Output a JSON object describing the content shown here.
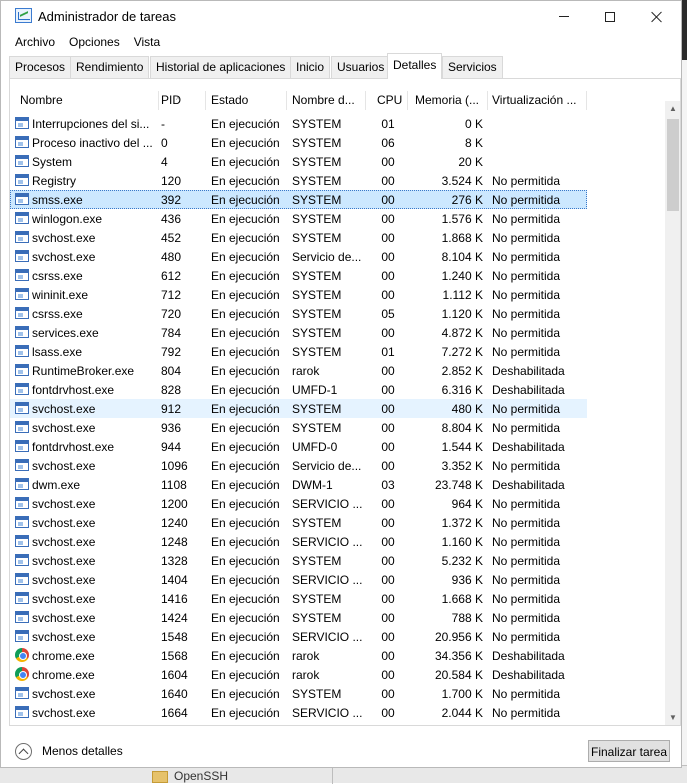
{
  "window": {
    "title": "Administrador de tareas"
  },
  "menu": [
    "Archivo",
    "Opciones",
    "Vista"
  ],
  "tabs": [
    {
      "label": "Procesos",
      "active": false
    },
    {
      "label": "Rendimiento",
      "active": false
    },
    {
      "label": "Historial de aplicaciones",
      "active": false
    },
    {
      "label": "Inicio",
      "active": false
    },
    {
      "label": "Usuarios",
      "active": false
    },
    {
      "label": "Detalles",
      "active": true
    },
    {
      "label": "Servicios",
      "active": false
    }
  ],
  "columns": [
    "Nombre",
    "PID",
    "Estado",
    "Nombre d...",
    "CPU",
    "Memoria (...",
    "Virtualización ..."
  ],
  "rows": [
    {
      "icon": "window-icon",
      "name": "Interrupciones del si...",
      "pid": "-",
      "estado": "En ejecución",
      "user": "SYSTEM",
      "cpu": "01",
      "mem": "0 K",
      "virt": ""
    },
    {
      "icon": "window-icon",
      "name": "Proceso inactivo del ...",
      "pid": "0",
      "estado": "En ejecución",
      "user": "SYSTEM",
      "cpu": "06",
      "mem": "8 K",
      "virt": ""
    },
    {
      "icon": "window-icon",
      "name": "System",
      "pid": "4",
      "estado": "En ejecución",
      "user": "SYSTEM",
      "cpu": "00",
      "mem": "20 K",
      "virt": ""
    },
    {
      "icon": "window-icon",
      "name": "Registry",
      "pid": "120",
      "estado": "En ejecución",
      "user": "SYSTEM",
      "cpu": "00",
      "mem": "3.524 K",
      "virt": "No permitida"
    },
    {
      "icon": "window-icon",
      "name": "smss.exe",
      "pid": "392",
      "estado": "En ejecución",
      "user": "SYSTEM",
      "cpu": "00",
      "mem": "276 K",
      "virt": "No permitida",
      "state": "selected"
    },
    {
      "icon": "window-icon",
      "name": "winlogon.exe",
      "pid": "436",
      "estado": "En ejecución",
      "user": "SYSTEM",
      "cpu": "00",
      "mem": "1.576 K",
      "virt": "No permitida"
    },
    {
      "icon": "window-icon",
      "name": "svchost.exe",
      "pid": "452",
      "estado": "En ejecución",
      "user": "SYSTEM",
      "cpu": "00",
      "mem": "1.868 K",
      "virt": "No permitida"
    },
    {
      "icon": "window-icon",
      "name": "svchost.exe",
      "pid": "480",
      "estado": "En ejecución",
      "user": "Servicio de...",
      "cpu": "00",
      "mem": "8.104 K",
      "virt": "No permitida"
    },
    {
      "icon": "window-icon",
      "name": "csrss.exe",
      "pid": "612",
      "estado": "En ejecución",
      "user": "SYSTEM",
      "cpu": "00",
      "mem": "1.240 K",
      "virt": "No permitida"
    },
    {
      "icon": "window-icon",
      "name": "wininit.exe",
      "pid": "712",
      "estado": "En ejecución",
      "user": "SYSTEM",
      "cpu": "00",
      "mem": "1.112 K",
      "virt": "No permitida"
    },
    {
      "icon": "window-icon",
      "name": "csrss.exe",
      "pid": "720",
      "estado": "En ejecución",
      "user": "SYSTEM",
      "cpu": "05",
      "mem": "1.120 K",
      "virt": "No permitida"
    },
    {
      "icon": "window-icon",
      "name": "services.exe",
      "pid": "784",
      "estado": "En ejecución",
      "user": "SYSTEM",
      "cpu": "00",
      "mem": "4.872 K",
      "virt": "No permitida"
    },
    {
      "icon": "window-icon",
      "name": "lsass.exe",
      "pid": "792",
      "estado": "En ejecución",
      "user": "SYSTEM",
      "cpu": "01",
      "mem": "7.272 K",
      "virt": "No permitida"
    },
    {
      "icon": "window-icon",
      "name": "RuntimeBroker.exe",
      "pid": "804",
      "estado": "En ejecución",
      "user": "rarok",
      "cpu": "00",
      "mem": "2.852 K",
      "virt": "Deshabilitada"
    },
    {
      "icon": "window-icon",
      "name": "fontdrvhost.exe",
      "pid": "828",
      "estado": "En ejecución",
      "user": "UMFD-1",
      "cpu": "00",
      "mem": "6.316 K",
      "virt": "Deshabilitada"
    },
    {
      "icon": "window-icon",
      "name": "svchost.exe",
      "pid": "912",
      "estado": "En ejecución",
      "user": "SYSTEM",
      "cpu": "00",
      "mem": "480 K",
      "virt": "No permitida",
      "state": "hover"
    },
    {
      "icon": "window-icon",
      "name": "svchost.exe",
      "pid": "936",
      "estado": "En ejecución",
      "user": "SYSTEM",
      "cpu": "00",
      "mem": "8.804 K",
      "virt": "No permitida"
    },
    {
      "icon": "window-icon",
      "name": "fontdrvhost.exe",
      "pid": "944",
      "estado": "En ejecución",
      "user": "UMFD-0",
      "cpu": "00",
      "mem": "1.544 K",
      "virt": "Deshabilitada"
    },
    {
      "icon": "window-icon",
      "name": "svchost.exe",
      "pid": "1096",
      "estado": "En ejecución",
      "user": "Servicio de...",
      "cpu": "00",
      "mem": "3.352 K",
      "virt": "No permitida"
    },
    {
      "icon": "window-icon",
      "name": "dwm.exe",
      "pid": "1108",
      "estado": "En ejecución",
      "user": "DWM-1",
      "cpu": "03",
      "mem": "23.748 K",
      "virt": "Deshabilitada"
    },
    {
      "icon": "window-icon",
      "name": "svchost.exe",
      "pid": "1200",
      "estado": "En ejecución",
      "user": "SERVICIO ...",
      "cpu": "00",
      "mem": "964 K",
      "virt": "No permitida"
    },
    {
      "icon": "window-icon",
      "name": "svchost.exe",
      "pid": "1240",
      "estado": "En ejecución",
      "user": "SYSTEM",
      "cpu": "00",
      "mem": "1.372 K",
      "virt": "No permitida"
    },
    {
      "icon": "window-icon",
      "name": "svchost.exe",
      "pid": "1248",
      "estado": "En ejecución",
      "user": "SERVICIO ...",
      "cpu": "00",
      "mem": "1.160 K",
      "virt": "No permitida"
    },
    {
      "icon": "window-icon",
      "name": "svchost.exe",
      "pid": "1328",
      "estado": "En ejecución",
      "user": "SYSTEM",
      "cpu": "00",
      "mem": "5.232 K",
      "virt": "No permitida"
    },
    {
      "icon": "window-icon",
      "name": "svchost.exe",
      "pid": "1404",
      "estado": "En ejecución",
      "user": "SERVICIO ...",
      "cpu": "00",
      "mem": "936 K",
      "virt": "No permitida"
    },
    {
      "icon": "window-icon",
      "name": "svchost.exe",
      "pid": "1416",
      "estado": "En ejecución",
      "user": "SYSTEM",
      "cpu": "00",
      "mem": "1.668 K",
      "virt": "No permitida"
    },
    {
      "icon": "window-icon",
      "name": "svchost.exe",
      "pid": "1424",
      "estado": "En ejecución",
      "user": "SYSTEM",
      "cpu": "00",
      "mem": "788 K",
      "virt": "No permitida"
    },
    {
      "icon": "window-icon",
      "name": "svchost.exe",
      "pid": "1548",
      "estado": "En ejecución",
      "user": "SERVICIO ...",
      "cpu": "00",
      "mem": "20.956 K",
      "virt": "No permitida"
    },
    {
      "icon": "chrome-icon",
      "name": "chrome.exe",
      "pid": "1568",
      "estado": "En ejecución",
      "user": "rarok",
      "cpu": "00",
      "mem": "34.356 K",
      "virt": "Deshabilitada"
    },
    {
      "icon": "chrome-icon",
      "name": "chrome.exe",
      "pid": "1604",
      "estado": "En ejecución",
      "user": "rarok",
      "cpu": "00",
      "mem": "20.584 K",
      "virt": "Deshabilitada"
    },
    {
      "icon": "window-icon",
      "name": "svchost.exe",
      "pid": "1640",
      "estado": "En ejecución",
      "user": "SYSTEM",
      "cpu": "00",
      "mem": "1.700 K",
      "virt": "No permitida"
    },
    {
      "icon": "window-icon",
      "name": "svchost.exe",
      "pid": "1664",
      "estado": "En ejecución",
      "user": "SERVICIO ...",
      "cpu": "00",
      "mem": "2.044 K",
      "virt": "No permitida"
    }
  ],
  "footer": {
    "less_details": "Menos detalles",
    "end_task": "Finalizar tarea"
  },
  "behind": {
    "folder_label": "OpenSSH"
  },
  "colors": {
    "selection": "#cce8ff",
    "hover": "#e5f3ff",
    "accent": "#3a6db8"
  }
}
